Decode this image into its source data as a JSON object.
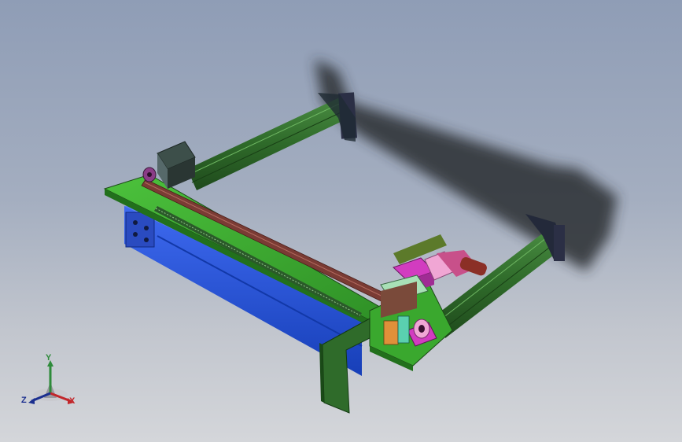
{
  "viewport": {
    "background_top": "#8f9db6",
    "background_bottom": "#d4d6da"
  },
  "model": {
    "colors": {
      "plate_green": "#3aa82e",
      "rail_green": "#2f6b2a",
      "beam_blue": "#2150d6",
      "belt_brown": "#7a3b34",
      "block_magenta": "#d23cc0",
      "block_pink": "#f0a6d4",
      "motor_dark": "#3d4f4a",
      "shadow": "#2a2d33"
    }
  },
  "triad": {
    "y_label": "Y",
    "z_label": "Z",
    "x_label": "X",
    "y_color": "#2e8b3a",
    "z_color": "#1b2f8f",
    "x_color": "#c2262a"
  }
}
